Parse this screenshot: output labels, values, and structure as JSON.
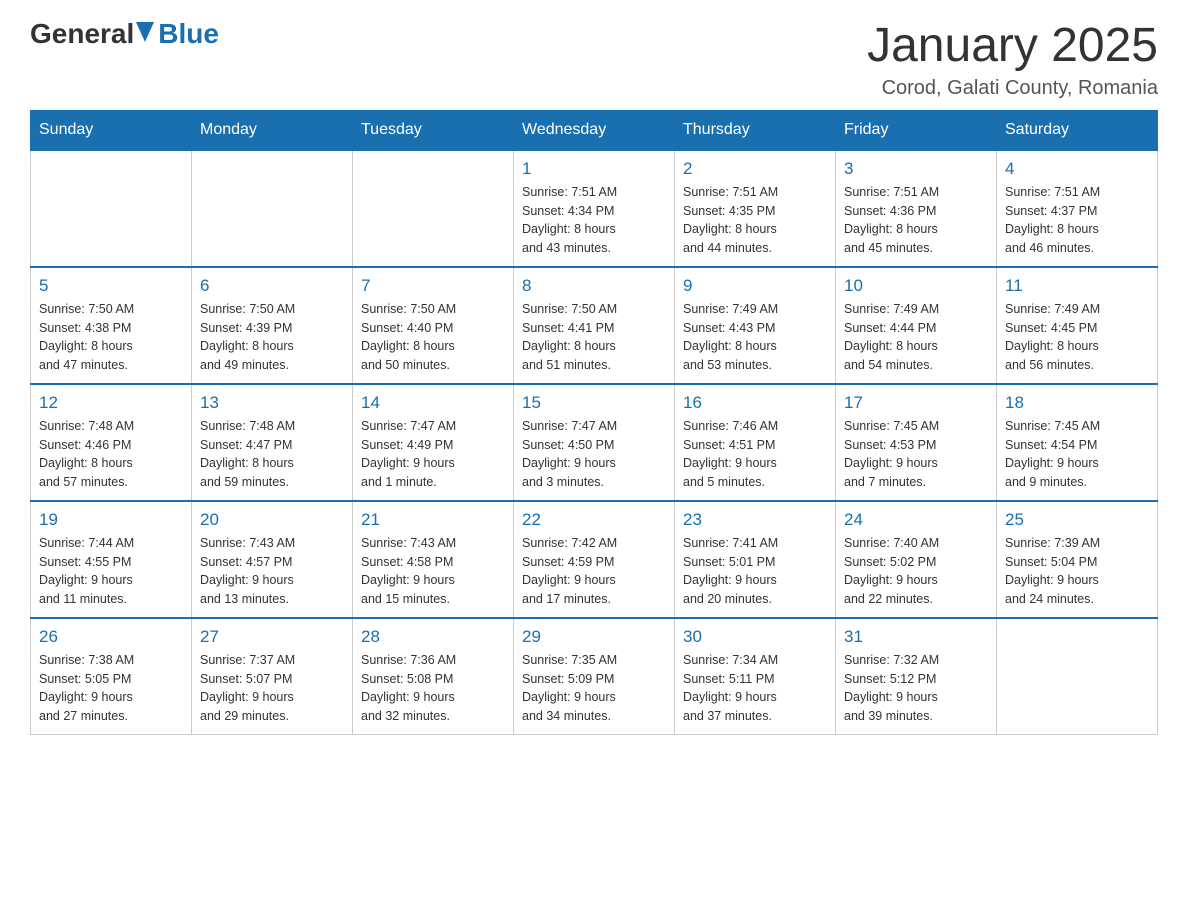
{
  "header": {
    "logo_general": "General",
    "logo_blue": "Blue",
    "month_title": "January 2025",
    "location": "Corod, Galati County, Romania"
  },
  "days_of_week": [
    "Sunday",
    "Monday",
    "Tuesday",
    "Wednesday",
    "Thursday",
    "Friday",
    "Saturday"
  ],
  "weeks": [
    [
      {
        "day": "",
        "info": ""
      },
      {
        "day": "",
        "info": ""
      },
      {
        "day": "",
        "info": ""
      },
      {
        "day": "1",
        "info": "Sunrise: 7:51 AM\nSunset: 4:34 PM\nDaylight: 8 hours\nand 43 minutes."
      },
      {
        "day": "2",
        "info": "Sunrise: 7:51 AM\nSunset: 4:35 PM\nDaylight: 8 hours\nand 44 minutes."
      },
      {
        "day": "3",
        "info": "Sunrise: 7:51 AM\nSunset: 4:36 PM\nDaylight: 8 hours\nand 45 minutes."
      },
      {
        "day": "4",
        "info": "Sunrise: 7:51 AM\nSunset: 4:37 PM\nDaylight: 8 hours\nand 46 minutes."
      }
    ],
    [
      {
        "day": "5",
        "info": "Sunrise: 7:50 AM\nSunset: 4:38 PM\nDaylight: 8 hours\nand 47 minutes."
      },
      {
        "day": "6",
        "info": "Sunrise: 7:50 AM\nSunset: 4:39 PM\nDaylight: 8 hours\nand 49 minutes."
      },
      {
        "day": "7",
        "info": "Sunrise: 7:50 AM\nSunset: 4:40 PM\nDaylight: 8 hours\nand 50 minutes."
      },
      {
        "day": "8",
        "info": "Sunrise: 7:50 AM\nSunset: 4:41 PM\nDaylight: 8 hours\nand 51 minutes."
      },
      {
        "day": "9",
        "info": "Sunrise: 7:49 AM\nSunset: 4:43 PM\nDaylight: 8 hours\nand 53 minutes."
      },
      {
        "day": "10",
        "info": "Sunrise: 7:49 AM\nSunset: 4:44 PM\nDaylight: 8 hours\nand 54 minutes."
      },
      {
        "day": "11",
        "info": "Sunrise: 7:49 AM\nSunset: 4:45 PM\nDaylight: 8 hours\nand 56 minutes."
      }
    ],
    [
      {
        "day": "12",
        "info": "Sunrise: 7:48 AM\nSunset: 4:46 PM\nDaylight: 8 hours\nand 57 minutes."
      },
      {
        "day": "13",
        "info": "Sunrise: 7:48 AM\nSunset: 4:47 PM\nDaylight: 8 hours\nand 59 minutes."
      },
      {
        "day": "14",
        "info": "Sunrise: 7:47 AM\nSunset: 4:49 PM\nDaylight: 9 hours\nand 1 minute."
      },
      {
        "day": "15",
        "info": "Sunrise: 7:47 AM\nSunset: 4:50 PM\nDaylight: 9 hours\nand 3 minutes."
      },
      {
        "day": "16",
        "info": "Sunrise: 7:46 AM\nSunset: 4:51 PM\nDaylight: 9 hours\nand 5 minutes."
      },
      {
        "day": "17",
        "info": "Sunrise: 7:45 AM\nSunset: 4:53 PM\nDaylight: 9 hours\nand 7 minutes."
      },
      {
        "day": "18",
        "info": "Sunrise: 7:45 AM\nSunset: 4:54 PM\nDaylight: 9 hours\nand 9 minutes."
      }
    ],
    [
      {
        "day": "19",
        "info": "Sunrise: 7:44 AM\nSunset: 4:55 PM\nDaylight: 9 hours\nand 11 minutes."
      },
      {
        "day": "20",
        "info": "Sunrise: 7:43 AM\nSunset: 4:57 PM\nDaylight: 9 hours\nand 13 minutes."
      },
      {
        "day": "21",
        "info": "Sunrise: 7:43 AM\nSunset: 4:58 PM\nDaylight: 9 hours\nand 15 minutes."
      },
      {
        "day": "22",
        "info": "Sunrise: 7:42 AM\nSunset: 4:59 PM\nDaylight: 9 hours\nand 17 minutes."
      },
      {
        "day": "23",
        "info": "Sunrise: 7:41 AM\nSunset: 5:01 PM\nDaylight: 9 hours\nand 20 minutes."
      },
      {
        "day": "24",
        "info": "Sunrise: 7:40 AM\nSunset: 5:02 PM\nDaylight: 9 hours\nand 22 minutes."
      },
      {
        "day": "25",
        "info": "Sunrise: 7:39 AM\nSunset: 5:04 PM\nDaylight: 9 hours\nand 24 minutes."
      }
    ],
    [
      {
        "day": "26",
        "info": "Sunrise: 7:38 AM\nSunset: 5:05 PM\nDaylight: 9 hours\nand 27 minutes."
      },
      {
        "day": "27",
        "info": "Sunrise: 7:37 AM\nSunset: 5:07 PM\nDaylight: 9 hours\nand 29 minutes."
      },
      {
        "day": "28",
        "info": "Sunrise: 7:36 AM\nSunset: 5:08 PM\nDaylight: 9 hours\nand 32 minutes."
      },
      {
        "day": "29",
        "info": "Sunrise: 7:35 AM\nSunset: 5:09 PM\nDaylight: 9 hours\nand 34 minutes."
      },
      {
        "day": "30",
        "info": "Sunrise: 7:34 AM\nSunset: 5:11 PM\nDaylight: 9 hours\nand 37 minutes."
      },
      {
        "day": "31",
        "info": "Sunrise: 7:32 AM\nSunset: 5:12 PM\nDaylight: 9 hours\nand 39 minutes."
      },
      {
        "day": "",
        "info": ""
      }
    ]
  ]
}
